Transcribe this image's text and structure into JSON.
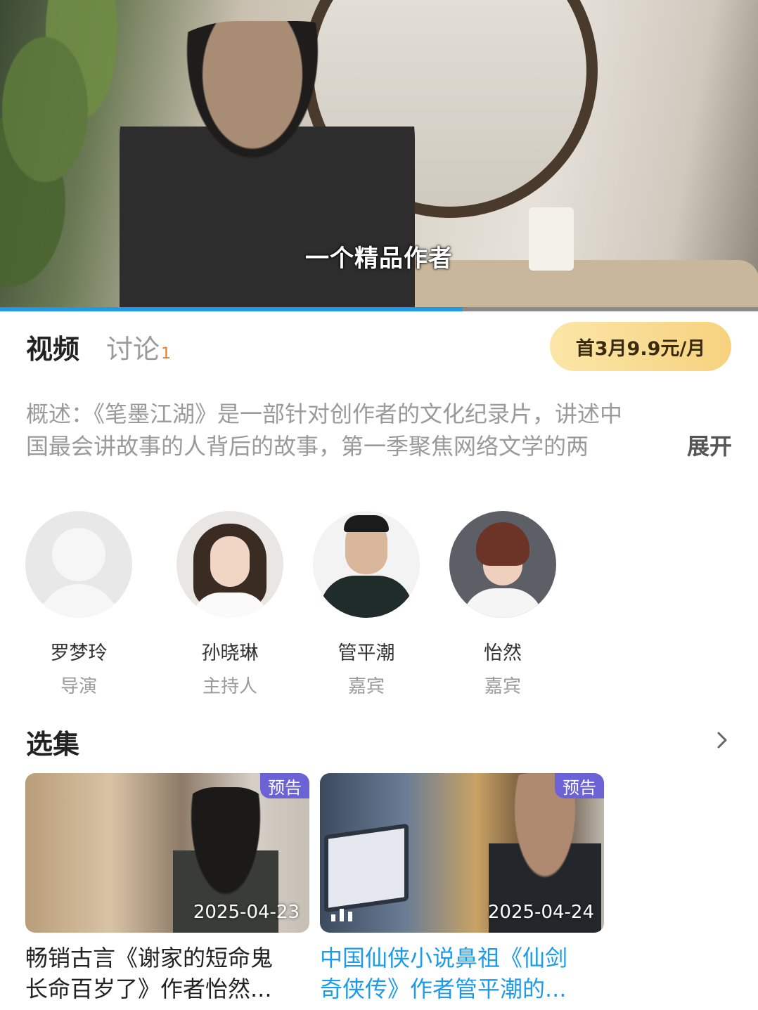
{
  "player": {
    "subtitle": "一个精品作者",
    "progress": 0.61
  },
  "tabs": {
    "video": "视频",
    "discussion": "讨论",
    "discussion_count": "1"
  },
  "subscribe": {
    "label": "首3月9.9元/月"
  },
  "description": {
    "line1": "概述：《笔墨江湖》是一部针对创作者的文化纪录片，讲述中",
    "line2": "国最会讲故事的人背后的故事，第一季聚焦网络文学的两",
    "expand": "展开"
  },
  "cast": [
    {
      "name": "罗梦玲",
      "role": "导演"
    },
    {
      "name": "孙晓琳",
      "role": "主持人"
    },
    {
      "name": "管平潮",
      "role": "嘉宾"
    },
    {
      "name": "怡然",
      "role": "嘉宾"
    }
  ],
  "episodes_section": {
    "title": "选集",
    "more_icon": "chevron-right-icon"
  },
  "episodes": [
    {
      "badge": "预告",
      "date": "2025-04-23",
      "title_line1": "畅销古言《谢家的短命鬼",
      "title_line2": "长命百岁了》作者怡然...",
      "active": false
    },
    {
      "badge": "预告",
      "date": "2025-04-24",
      "title_line1": "中国仙侠小说鼻祖《仙剑",
      "title_line2": "奇侠传》作者管平潮的...",
      "active": true
    }
  ],
  "colors": {
    "accent": "#1e9be8",
    "badge": "#6b62d6",
    "subscribe_bg": "#f6d27e",
    "count": "#f07a2a"
  }
}
